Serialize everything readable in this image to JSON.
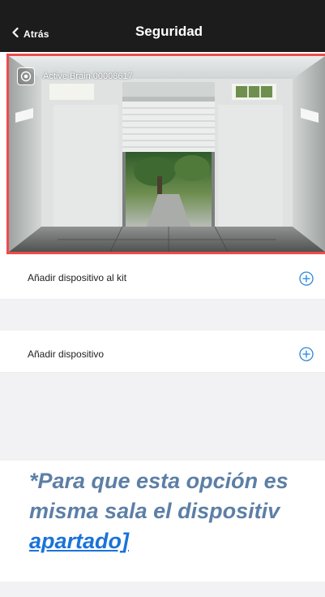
{
  "header": {
    "back_label": "Atrás",
    "title": "Seguridad"
  },
  "camera": {
    "device_name": "Active Brain 00008617"
  },
  "rows": [
    {
      "label": "Añadir dispositivo al kit",
      "icon": "plus-circle-icon"
    },
    {
      "label": "Añadir dispositivo",
      "icon": "plus-circle-icon"
    }
  ],
  "note": {
    "line1": "*Para que esta opción es",
    "line2": "misma sala el dispositiv",
    "link": "apartado]"
  },
  "colors": {
    "header_bg": "#1c1c1c",
    "camera_border": "#ef4b4b",
    "accent": "#2a86d9",
    "note_text": "#5d7fa6",
    "link": "#1a73d9"
  }
}
